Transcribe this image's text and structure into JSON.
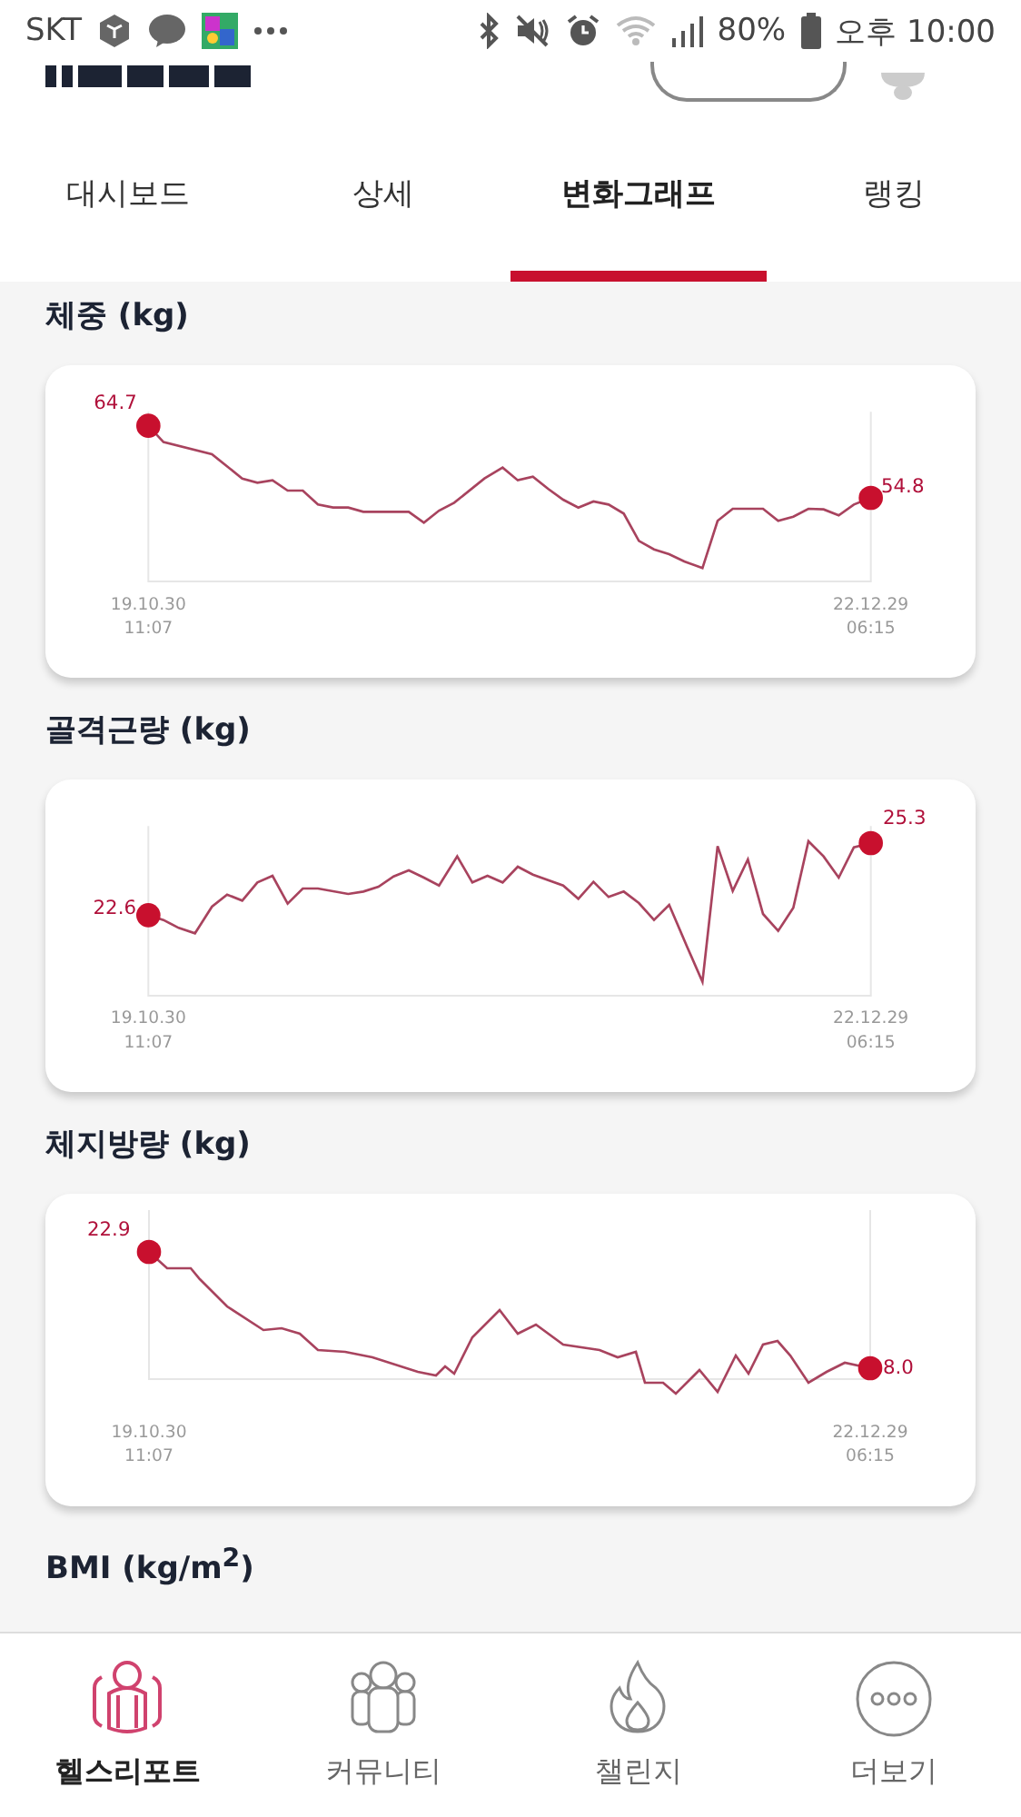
{
  "status_bar": {
    "carrier": "SKT",
    "battery": "80%",
    "time": "오후 10:00"
  },
  "tabs": [
    {
      "label": "대시보드",
      "selected": false
    },
    {
      "label": "상세",
      "selected": false
    },
    {
      "label": "변화그래프",
      "selected": true
    },
    {
      "label": "랭킹",
      "selected": false
    }
  ],
  "sections": [
    {
      "title": "체중 (kg)",
      "start_value": "64.7",
      "end_value": "54.8",
      "start_date": "19.10.30",
      "start_time": "11:07",
      "end_date": "22.12.29",
      "end_time": "06:15"
    },
    {
      "title": "골격근량 (kg)",
      "start_value": "22.6",
      "end_value": "25.3",
      "start_date": "19.10.30",
      "start_time": "11:07",
      "end_date": "22.12.29",
      "end_time": "06:15"
    },
    {
      "title": "체지방량 (kg)",
      "start_value": "22.9",
      "end_value": "8.0",
      "start_date": "19.10.30",
      "start_time": "11:07",
      "end_date": "22.12.29",
      "end_time": "06:15"
    },
    {
      "title": "BMI (kg/m$^{2}$)"
    }
  ],
  "bottom_nav": [
    {
      "label": "헬스리포트",
      "kind": "report",
      "selected": true
    },
    {
      "label": "커뮤니티",
      "kind": "community",
      "selected": false
    },
    {
      "label": "챌린지",
      "kind": "challenge",
      "selected": false
    },
    {
      "label": "더보기",
      "kind": "more",
      "selected": false
    }
  ]
}
